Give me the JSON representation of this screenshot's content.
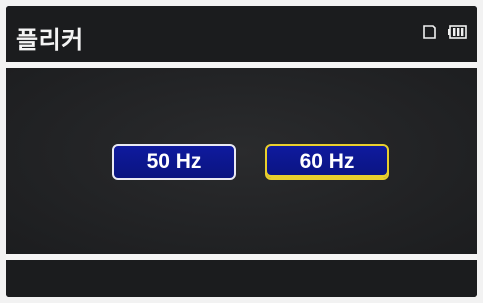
{
  "header": {
    "title": "플리커",
    "status_icons": [
      "memory-card-icon",
      "battery-icon"
    ]
  },
  "options": [
    {
      "label": "50 Hz",
      "selected": false
    },
    {
      "label": "60 Hz",
      "selected": true
    }
  ],
  "colors": {
    "background": "#1e1f21",
    "divider": "#f5f5f5",
    "button_fill": "#0f1a9e",
    "button_border": "#e9e9f2",
    "selected_border": "#e9cf2d"
  }
}
